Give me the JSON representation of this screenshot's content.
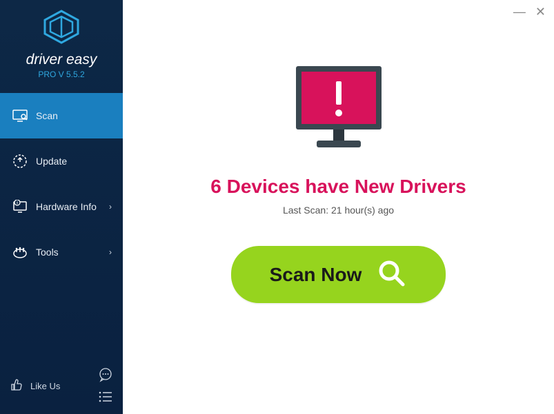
{
  "brand": {
    "name": "driver easy",
    "version": "PRO V 5.5.2"
  },
  "sidebar": {
    "items": [
      {
        "label": "Scan",
        "active": true,
        "has_chevron": false
      },
      {
        "label": "Update",
        "active": false,
        "has_chevron": false
      },
      {
        "label": "Hardware Info",
        "active": false,
        "has_chevron": true
      },
      {
        "label": "Tools",
        "active": false,
        "has_chevron": true
      }
    ],
    "footer": {
      "like_label": "Like Us"
    }
  },
  "main": {
    "headline": "6 Devices have New Drivers",
    "last_scan": "Last Scan: 21 hour(s) ago",
    "scan_button": "Scan Now"
  },
  "colors": {
    "sidebar_bg": "#0d2846",
    "active_bg": "#1a7fbf",
    "accent": "#2fa8e0",
    "headline": "#d8125b",
    "scan_btn": "#96d41e",
    "monitor_screen": "#d8125b"
  }
}
